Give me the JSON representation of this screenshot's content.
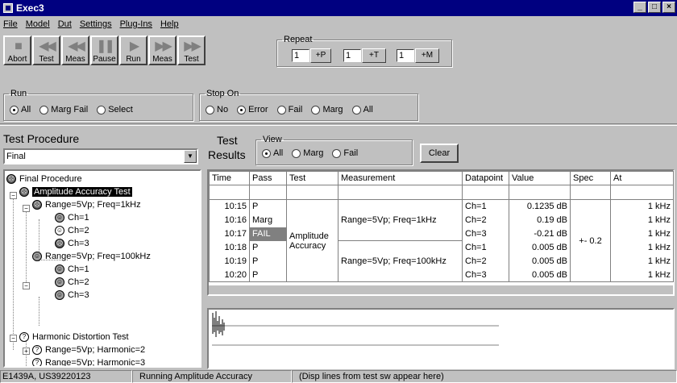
{
  "window": {
    "title": "Exec3",
    "minimize": "_",
    "maximize": "□",
    "close": "×"
  },
  "menu": [
    "File",
    "Model",
    "Dut",
    "Settings",
    "Plug-Ins",
    "Help"
  ],
  "toolbar": {
    "abort": "Abort",
    "test_back": "Test",
    "meas_back": "Meas",
    "pause": "Pause",
    "run": "Run",
    "meas_fwd": "Meas",
    "test_fwd": "Test"
  },
  "repeat": {
    "legend": "Repeat",
    "p_value": "1",
    "p_button": "+P",
    "t_value": "1",
    "t_button": "+T",
    "m_value": "1",
    "m_button": "+M"
  },
  "run_group": {
    "legend": "Run",
    "options": [
      "All",
      "Marg Fail",
      "Select"
    ],
    "selected": "All"
  },
  "stopon_group": {
    "legend": "Stop On",
    "options": [
      "No",
      "Error",
      "Fail",
      "Marg",
      "All"
    ],
    "selected": "Error"
  },
  "left": {
    "title": "Test Procedure",
    "procedure_value": "Final",
    "tree": [
      {
        "label": "Final Procedure",
        "icon": "sad-face-icon"
      },
      {
        "label": "Amplitude Accuracy Test",
        "icon": "sad-face-icon",
        "selected": true
      },
      {
        "label": "Range=5Vp; Freq=1kHz",
        "icon": "sad-face-icon"
      },
      {
        "label": "Ch=1",
        "icon": "happy-face-icon"
      },
      {
        "label": "Ch=2",
        "icon": "neutral-face-icon"
      },
      {
        "label": "Ch=3",
        "icon": "sad-face-icon"
      },
      {
        "label": "Range=5Vp; Freq=100kHz",
        "icon": "happy-face-icon"
      },
      {
        "label": "Ch=1",
        "icon": "happy-face-icon"
      },
      {
        "label": "Ch=2",
        "icon": "happy-face-icon"
      },
      {
        "label": "Ch=3",
        "icon": "happy-face-icon"
      },
      {
        "label": "Harmonic Distortion Test",
        "icon": "question-icon"
      },
      {
        "label": "Range=5Vp; Harmonic=2",
        "icon": "question-icon"
      },
      {
        "label": "Range=5Vp; Harmonic=3",
        "icon": "question-icon"
      }
    ]
  },
  "results": {
    "title_line1": "Test",
    "title_line2": "Results",
    "view_legend": "View",
    "view_options": [
      "All",
      "Marg",
      "Fail"
    ],
    "view_selected": "All",
    "clear": "Clear",
    "columns": [
      "Time",
      "Pass",
      "Test",
      "Measurement",
      "Datapoint",
      "Value",
      "Spec",
      "At"
    ],
    "test_name_line1": "Amplitude",
    "test_name_line2": "Accuracy",
    "measurement_1": "Range=5Vp; Freq=1kHz",
    "measurement_2": "Range=5Vp; Freq=100kHz",
    "spec": "+- 0.2",
    "rows": [
      {
        "time": "10:15",
        "pass": "P",
        "datapoint": "Ch=1",
        "value": "0.1235 dB",
        "at": "1 kHz"
      },
      {
        "time": "10:16",
        "pass": "Marg",
        "datapoint": "Ch=2",
        "value": "0.19 dB",
        "at": "1 kHz"
      },
      {
        "time": "10:17",
        "pass": "FAIL",
        "datapoint": "Ch=3",
        "value": "-0.21 dB",
        "at": "1 kHz"
      },
      {
        "time": "10:18",
        "pass": "P",
        "datapoint": "Ch=1",
        "value": "0.005 dB",
        "at": "1 kHz"
      },
      {
        "time": "10:19",
        "pass": "P",
        "datapoint": "Ch=2",
        "value": "0.005 dB",
        "at": "1 kHz"
      },
      {
        "time": "10:20",
        "pass": "P",
        "datapoint": "Ch=3",
        "value": "0.005 dB",
        "at": "1 kHz"
      }
    ]
  },
  "status": {
    "instrument": "E1439A, US39220123",
    "running": "Running Amplitude Accuracy",
    "message": "(Disp lines from test sw appear here)"
  }
}
